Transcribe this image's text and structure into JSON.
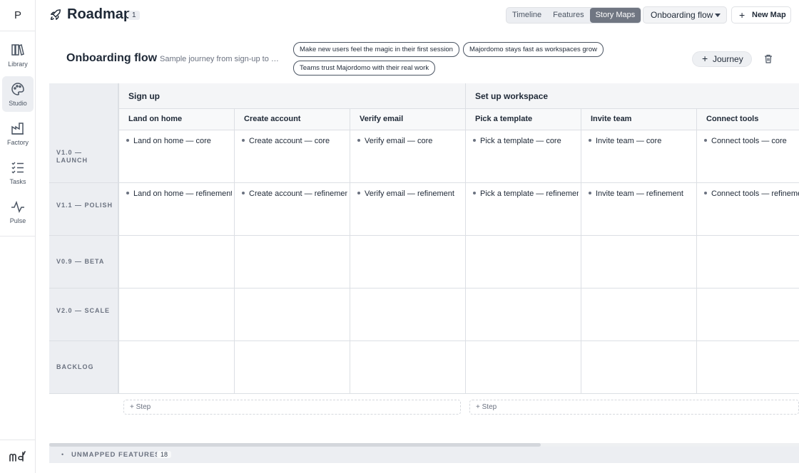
{
  "sidebar": {
    "logo_letter": "P",
    "items": [
      {
        "label": "Library",
        "icon": "library-icon"
      },
      {
        "label": "Studio",
        "icon": "palette-icon"
      },
      {
        "label": "Factory",
        "icon": "factory-icon"
      },
      {
        "label": "Tasks",
        "icon": "tasks-icon"
      },
      {
        "label": "Pulse",
        "icon": "pulse-icon"
      }
    ]
  },
  "header": {
    "title": "Roadmap",
    "count": "1",
    "views": [
      "Timeline",
      "Features",
      "Story Maps"
    ],
    "active_view": "Story Maps",
    "selected_map": "Onboarding flow",
    "new_map_label": "New Map"
  },
  "map": {
    "title": "Onboarding flow",
    "description": "Sample journey from sign-up to first value",
    "goals": [
      "Make new users feel the magic in their first session",
      "Majordomo stays fast as workspaces grow",
      "Teams trust Majordomo with their real work"
    ],
    "journey_label": "Journey"
  },
  "activities": [
    {
      "name": "Sign up"
    },
    {
      "name": "Set up workspace"
    }
  ],
  "steps": [
    "Land on home",
    "Create account",
    "Verify email",
    "Pick a template",
    "Invite team",
    "Connect tools"
  ],
  "releases": [
    "V1.0 — LAUNCH",
    "V1.1 — POLISH",
    "V0.9 — BETA",
    "V2.0 — SCALE",
    "BACKLOG"
  ],
  "cards": [
    [
      "Land on home — core",
      "Create account — core",
      "Verify email — core",
      "Pick a template — core",
      "Invite team — core",
      "Connect tools — core"
    ],
    [
      "Land on home — refinement",
      "Create account — refinement",
      "Verify email — refinement",
      "Pick a template — refinement",
      "Invite team — refinement",
      "Connect tools — refinement"
    ]
  ],
  "add_step_label": "+ Step",
  "unmapped": {
    "label": "UNMAPPED FEATURES",
    "count": "18"
  }
}
